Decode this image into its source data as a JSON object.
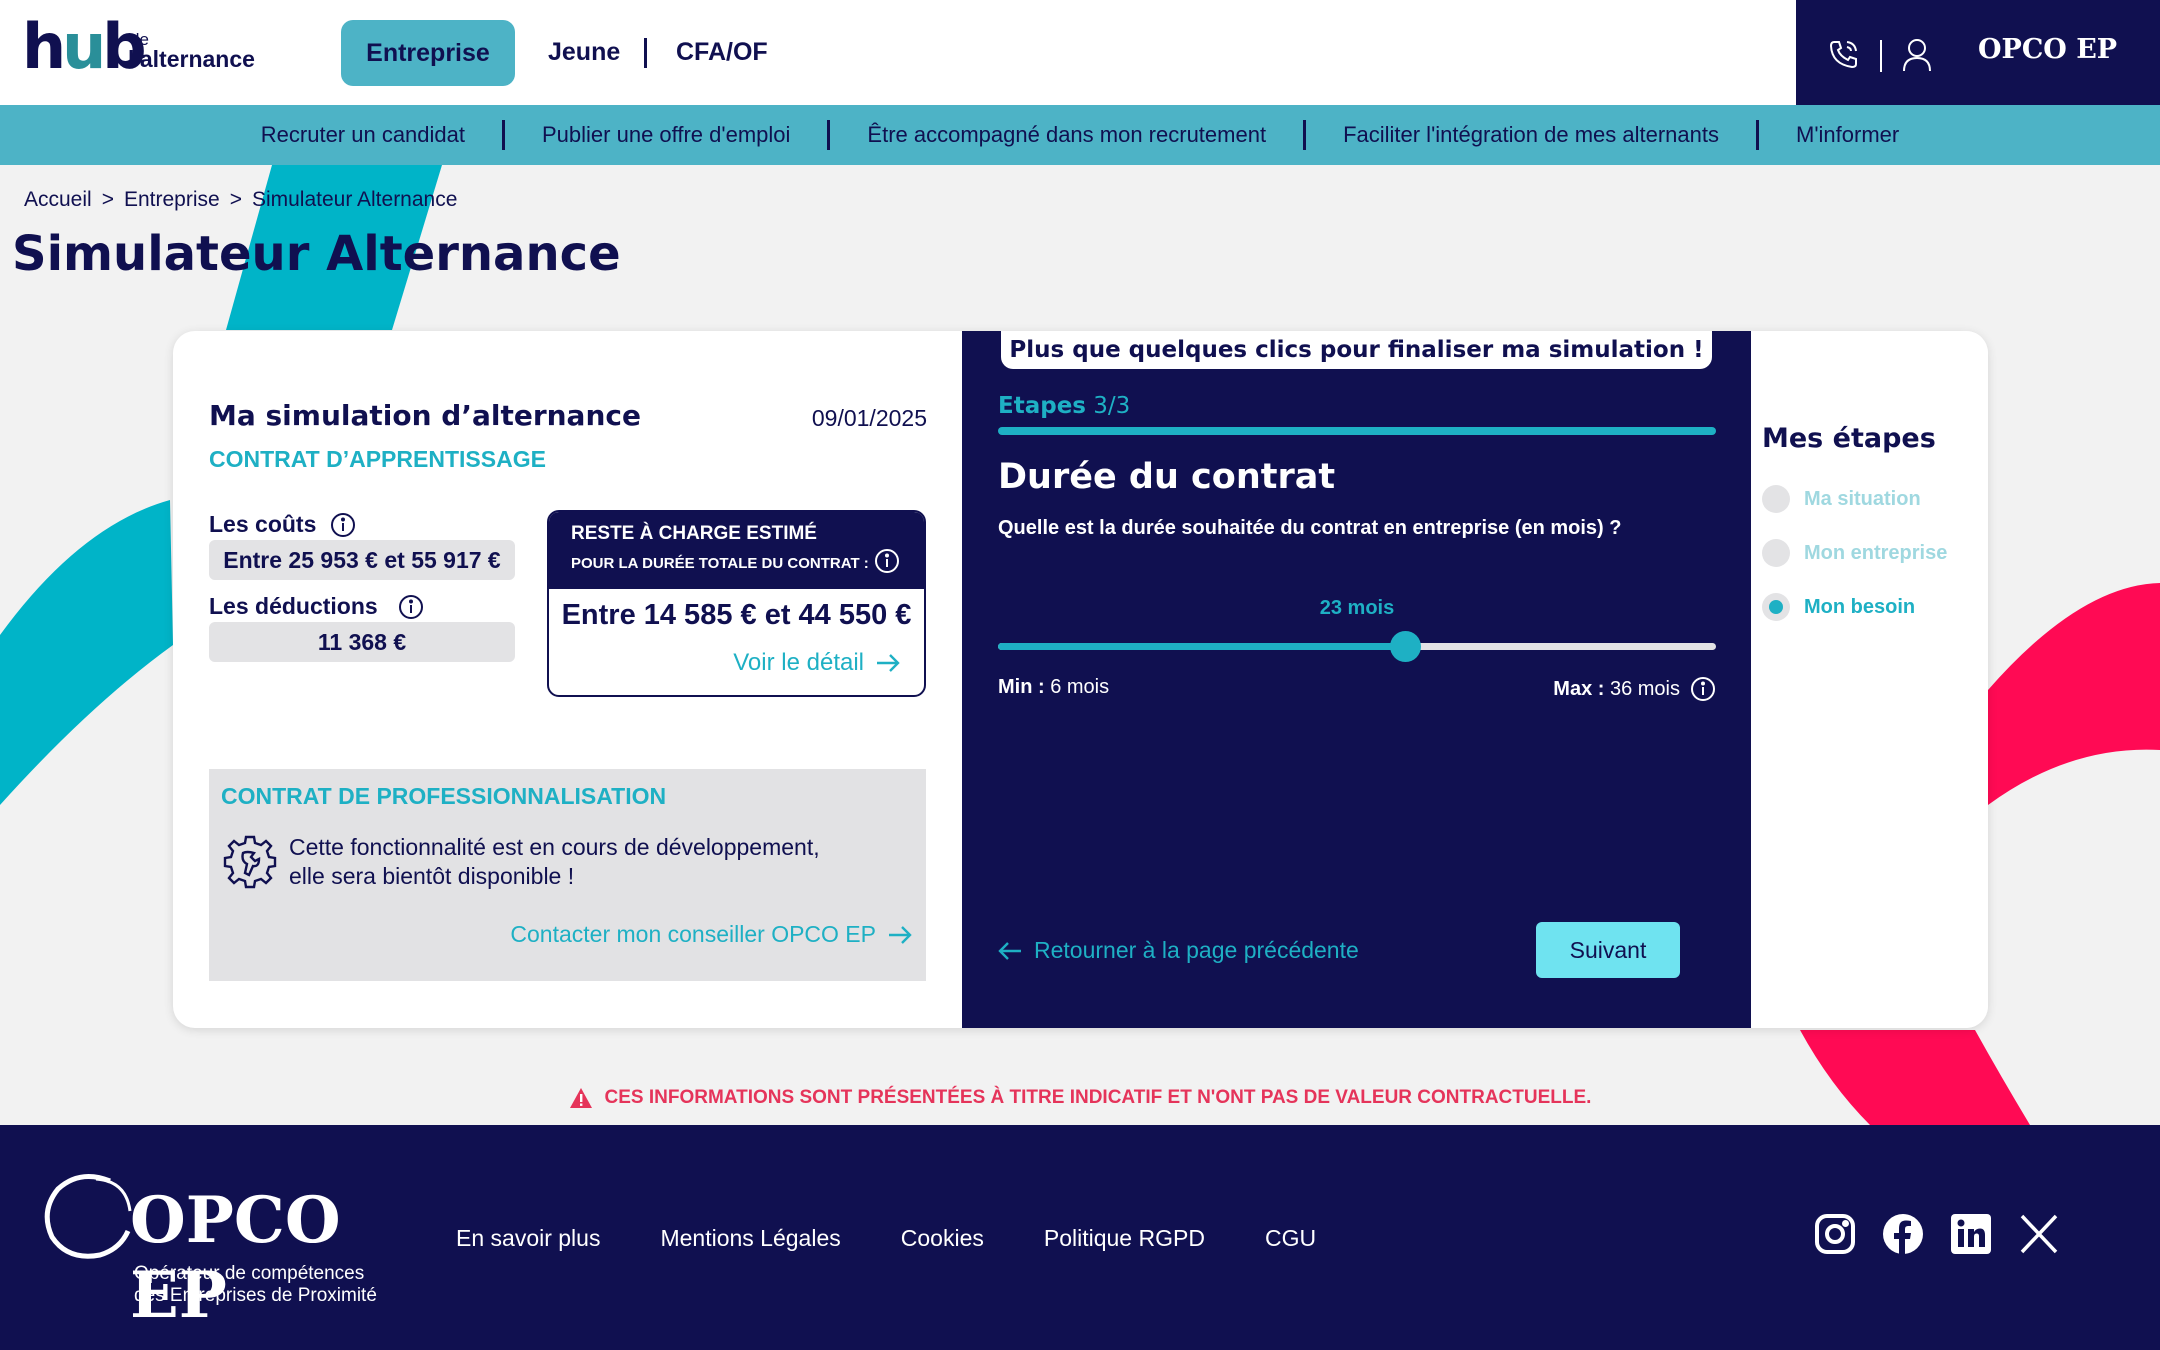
{
  "header": {
    "logo": {
      "hub": "hub",
      "de": "de",
      "alternance": "l'alternance"
    },
    "tabs": [
      {
        "label": "Entreprise",
        "active": true
      },
      {
        "label": "Jeune"
      },
      {
        "label": "CFA/OF"
      }
    ],
    "right": {
      "phone_icon": "phone-icon",
      "user_icon": "user-icon",
      "brand": "OPCO EP"
    }
  },
  "nav": {
    "items": [
      "Recruter un candidat",
      "Publier une offre d'emploi",
      "Être accompagné dans mon recrutement",
      "Faciliter l'intégration de mes alternants",
      "M'informer"
    ]
  },
  "breadcrumb": [
    "Accueil",
    "Entreprise",
    "Simulateur Alternance"
  ],
  "page_title": "Simulateur Alternance",
  "simulation": {
    "title": "Ma simulation d’alternance",
    "date": "09/01/2025",
    "contract_type": "CONTRAT D’APPRENTISSAGE",
    "costs_label": "Les coûts",
    "costs_value": "Entre 25 953 € et 55 917 €",
    "deductions_label": "Les déductions",
    "deductions_value": "11 368 €",
    "reste": {
      "title": "RESTE À CHARGE ESTIMÉ",
      "subtitle": "POUR LA DURÉE TOTALE DU CONTRAT :",
      "amount": "Entre 14 585 € et 44 550 €",
      "link": "Voir le détail"
    },
    "pro": {
      "title": "CONTRAT DE PROFESSIONNALISATION",
      "text_line1": "Cette fonctionnalité est en cours de développement,",
      "text_line2": "elle sera bientôt disponible !",
      "link": "Contacter mon conseiller OPCO EP"
    }
  },
  "form": {
    "banner": "Plus que quelques clics pour finaliser ma simulation !",
    "steps_prefix": "Etapes",
    "steps_value": "3/3",
    "progress": 1.0,
    "title": "Durée du contrat",
    "question": "Quelle est la durée souhaitée du contrat en entreprise (en mois) ?",
    "slider": {
      "value_label": "23 mois",
      "value": 23,
      "min": 6,
      "max": 36,
      "min_key": "Min :",
      "min_text": "6 mois",
      "max_key": "Max :",
      "max_text": "36 mois"
    },
    "back_link": "Retourner à la page précédente",
    "next_button": "Suivant"
  },
  "mes_etapes": {
    "title": "Mes étapes",
    "items": [
      {
        "label": "Ma situation",
        "active": false
      },
      {
        "label": "Mon entreprise",
        "active": false
      },
      {
        "label": "Mon besoin",
        "active": true
      }
    ]
  },
  "warning": "CES INFORMATIONS SONT PRÉSENTÉES À TITRE INDICATIF ET N'ONT PAS DE VALEUR CONTRACTUELLE.",
  "footer": {
    "brand": "OPCO EP",
    "tagline1": "Opérateur de compétences",
    "tagline2": "des Entreprises de Proximité",
    "links": [
      "En savoir plus",
      "Mentions Légales",
      "Cookies",
      "Politique RGPD",
      "CGU"
    ],
    "social": [
      "instagram-icon",
      "facebook-icon",
      "linkedin-icon",
      "x-icon"
    ]
  },
  "colors": {
    "navy": "#101050",
    "teal": "#4db3c6",
    "cyan": "#1eb0c4",
    "pink": "#ff0a54",
    "button": "#6fe3f0"
  }
}
